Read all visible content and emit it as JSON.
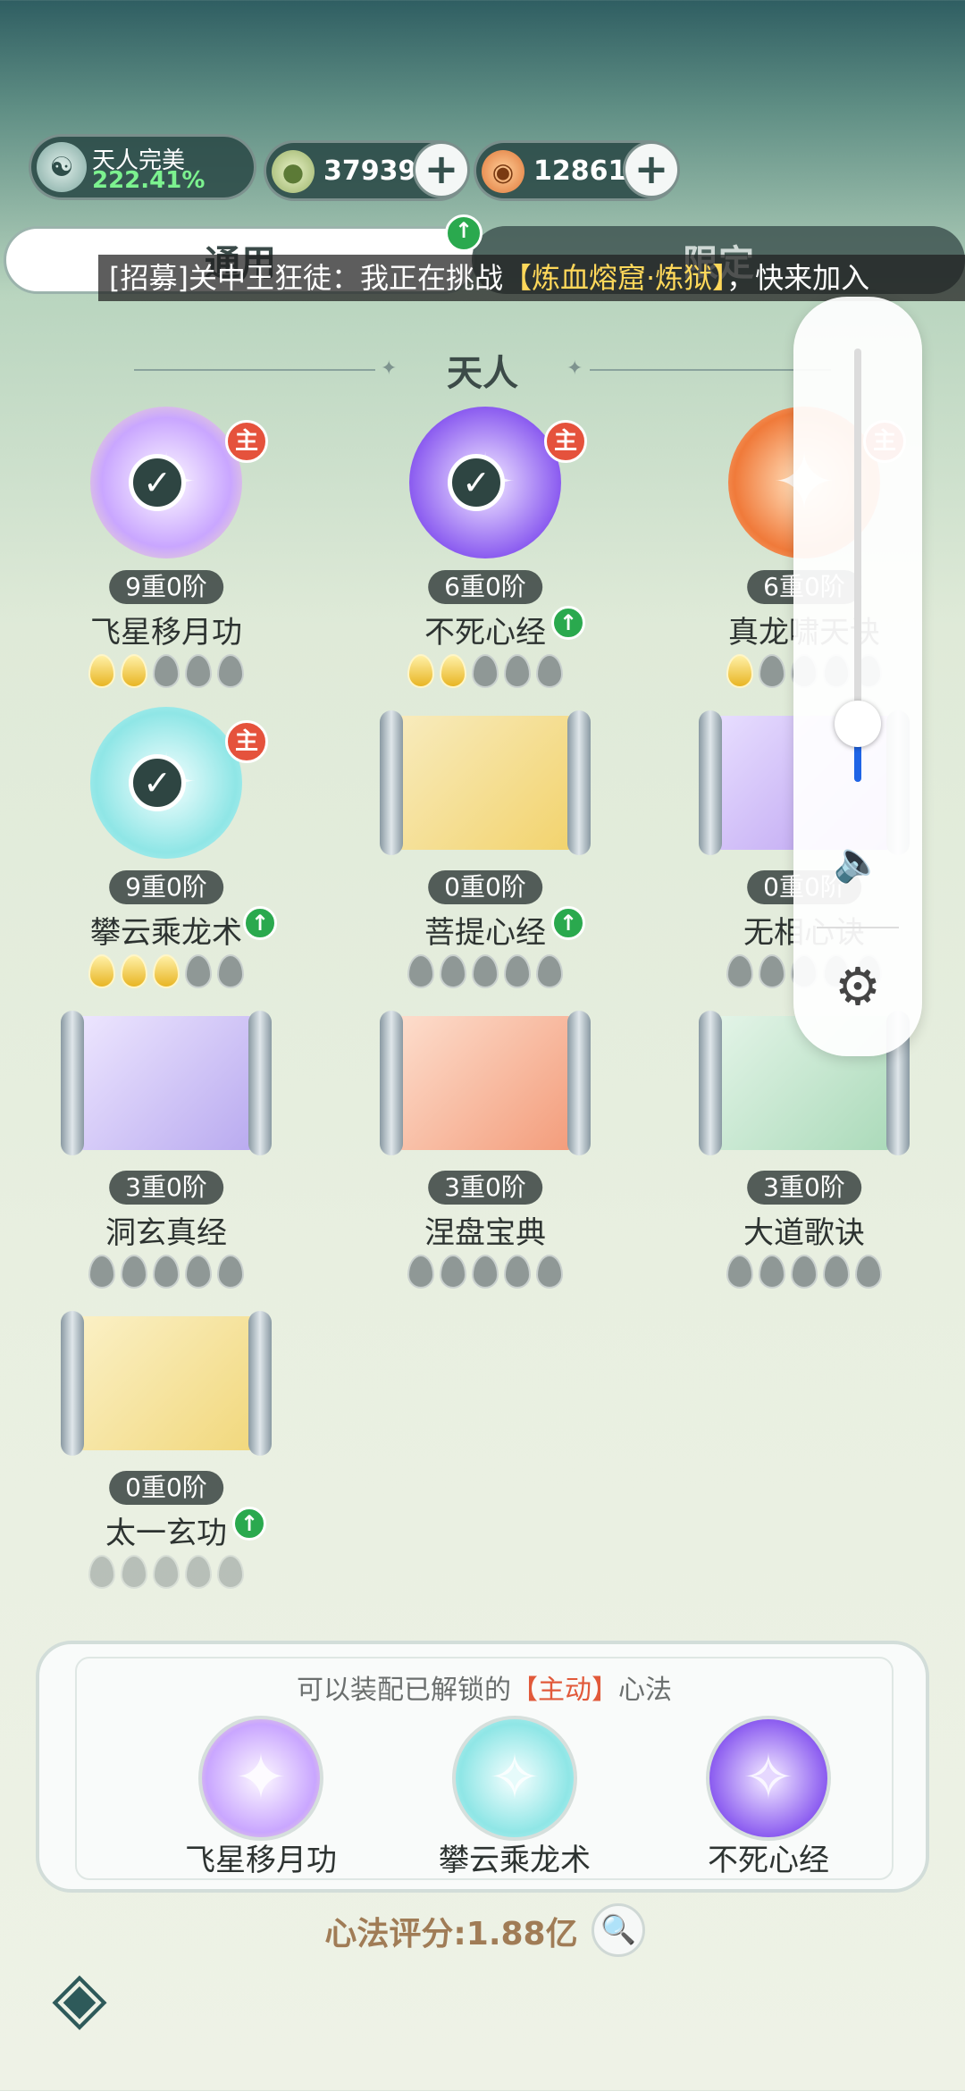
{
  "header": {
    "realm": {
      "name": "天人完美",
      "percent": "222.41%"
    },
    "currencies": [
      {
        "icon": "jade-drop-icon",
        "value": "37939"
      },
      {
        "icon": "spiral-gem-icon",
        "value": "12861"
      }
    ]
  },
  "tabs": [
    {
      "label": "通用"
    },
    {
      "label": "限定"
    }
  ],
  "recruit": {
    "prefix": "[招募]关中王狂徒：我正在挑战",
    "highlight": "【炼血熔窟·炼狱】",
    "suffix": "，快来加入"
  },
  "section": {
    "title": "天人"
  },
  "skills": [
    {
      "level": "9重0阶",
      "name": "飞星移月功",
      "stars_on": 2,
      "equipped": true,
      "main": true,
      "upgrade": false
    },
    {
      "level": "6重0阶",
      "name": "不死心经",
      "stars_on": 2,
      "equipped": true,
      "main": true,
      "upgrade": true
    },
    {
      "level": "6重0阶",
      "name": "真龙啸天诀",
      "stars_on": 1,
      "equipped": false,
      "main": true,
      "upgrade": false
    },
    {
      "level": "9重0阶",
      "name": "攀云乘龙术",
      "stars_on": 3,
      "equipped": true,
      "main": true,
      "upgrade": true
    },
    {
      "level": "0重0阶",
      "name": "菩提心经",
      "stars_on": 0,
      "equipped": false,
      "main": false,
      "upgrade": true
    },
    {
      "level": "0重0阶",
      "name": "无相心诀",
      "stars_on": 0,
      "equipped": false,
      "main": false,
      "upgrade": false
    },
    {
      "level": "3重0阶",
      "name": "洞玄真经",
      "stars_on": 0,
      "equipped": false,
      "main": false,
      "upgrade": false
    },
    {
      "level": "3重0阶",
      "name": "涅盘宝典",
      "stars_on": 0,
      "equipped": false,
      "main": false,
      "upgrade": false
    },
    {
      "level": "3重0阶",
      "name": "大道歌诀",
      "stars_on": 0,
      "equipped": false,
      "main": false,
      "upgrade": false
    },
    {
      "level": "0重0阶",
      "name": "太一玄功",
      "stars_on": 0,
      "equipped": false,
      "main": false,
      "upgrade": true
    }
  ],
  "colors": {
    "orb1": "#c9a6ff",
    "orb2": "#8b5cf0",
    "orb3": "#f07a3a",
    "orb4": "#8fe6e6",
    "scroll_gold": "#f2d26a",
    "scroll_purple": "#b89cf0",
    "scroll_violet": "#b7a8ef",
    "scroll_red": "#f39a78",
    "scroll_green": "#a9d9b8",
    "scroll_dragon": "#f1d77a"
  },
  "equip_panel": {
    "hint_prefix": "可以装配已解锁的",
    "hint_active": "【主动】",
    "hint_suffix": "心法",
    "slots": [
      {
        "name": "飞星移月功"
      },
      {
        "name": "攀云乘龙术"
      },
      {
        "name": "不死心经"
      }
    ]
  },
  "score": {
    "label": "心法评分:1.88亿"
  }
}
